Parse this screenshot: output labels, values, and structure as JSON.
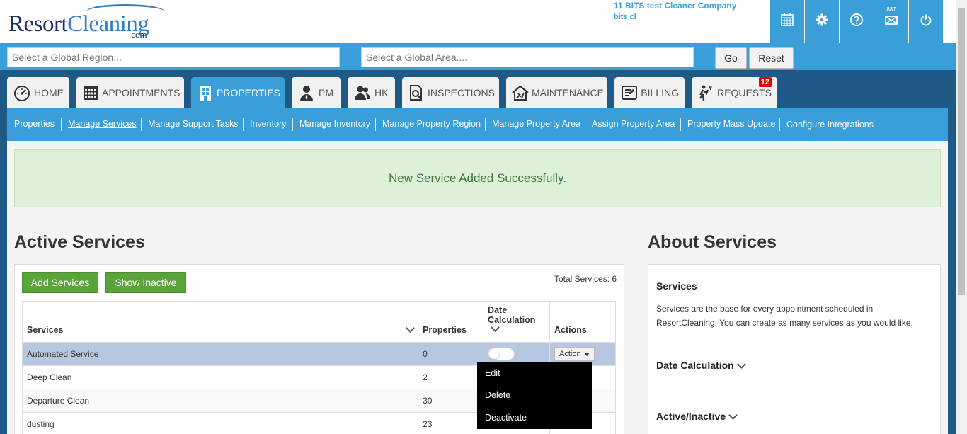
{
  "header": {
    "logo_main": "Resort",
    "logo_accent": "Cleaning",
    "logo_com": ".com",
    "company_name": "11 BITS test Cleaner Company",
    "user_name": "bits cl",
    "message_count": "887",
    "icons": [
      "calendar-grid-icon",
      "gear-icon",
      "help-icon",
      "mail-icon",
      "power-icon"
    ]
  },
  "filter": {
    "region_placeholder": "Select a Global Region...",
    "area_placeholder": "Select a Global Area....",
    "go_label": "Go",
    "reset_label": "Reset"
  },
  "tabs": [
    {
      "label": "HOME",
      "icon": "dashboard-icon"
    },
    {
      "label": "APPOINTMENTS",
      "icon": "calendar-icon"
    },
    {
      "label": "PROPERTIES",
      "icon": "building-icon"
    },
    {
      "label": "PM",
      "icon": "person-icon"
    },
    {
      "label": "HK",
      "icon": "people-icon"
    },
    {
      "label": "INSPECTIONS",
      "icon": "inspection-icon"
    },
    {
      "label": "MAINTENANCE",
      "icon": "house-tools-icon"
    },
    {
      "label": "BILLING",
      "icon": "invoice-icon"
    },
    {
      "label": "REQUESTS",
      "icon": "request-icon",
      "badge": "12"
    }
  ],
  "subnav": [
    "Properties",
    "Manage Services",
    "Manage Support Tasks",
    "Inventory",
    "Manage Inventory",
    "Manage Property Region",
    "Manage Property Area",
    "Assign Property Area",
    "Property Mass Update",
    "Configure Integrations"
  ],
  "alert": {
    "message": "New Service Added Successfully."
  },
  "active_services": {
    "title": "Active Services",
    "add_label": "Add Services",
    "inactive_label": "Show Inactive",
    "total_label": "Total Services: 6",
    "columns": {
      "services": "Services",
      "properties": "Properties",
      "date_calc_line1": "Date",
      "date_calc_line2": "Calculation",
      "actions": "Actions"
    },
    "rows": [
      {
        "name": "Automated Service",
        "properties": "0"
      },
      {
        "name": "Deep Clean",
        "properties": "2"
      },
      {
        "name": "Departure Clean",
        "properties": "30"
      },
      {
        "name": "dusting",
        "properties": "23"
      }
    ],
    "action_label": "Action",
    "dropdown": [
      "Edit",
      "Delete",
      "Deactivate"
    ]
  },
  "about": {
    "title": "About Services",
    "heading": "Services",
    "text": "Services are the base for every appointment scheduled in ResortCleaning. You can create as many services as you would like.",
    "section1": "Date Calculation",
    "section2": "Active/Inactive"
  },
  "colors": {
    "brand_blue": "#3a9fd8",
    "dark_blue": "#1f5a86",
    "success_bg": "#dff0d8",
    "success_text": "#3c763d",
    "green_button": "#5aa43a",
    "badge_red": "#e60000"
  }
}
